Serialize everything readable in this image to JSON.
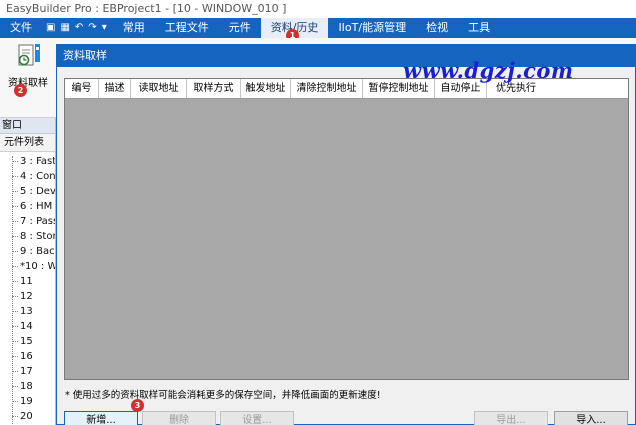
{
  "window": {
    "title": "EasyBuilder Pro : EBProject1 - [10 - WINDOW_010 ]"
  },
  "menubar": {
    "file": "文件",
    "qat_save": "▣",
    "qat_grid": "▦",
    "qat_undo": "↶",
    "qat_redo": "↷",
    "qat_more": "▾",
    "items": [
      "常用",
      "工程文件",
      "元件",
      "资料/历史",
      "IIoT/能源管理",
      "检视",
      "工具"
    ],
    "active_index": 3
  },
  "ribbon": {
    "data_sampling": "资料取样"
  },
  "badges": [
    "1",
    "2",
    "3"
  ],
  "sidebar": {
    "header": "窗口",
    "tab": "元件列表",
    "items": [
      "3 : Fast",
      "4 : Con",
      "5 : Dev",
      "6 : HM",
      "7 : Pass",
      "8 : Stor",
      "9 : Bac",
      "*10 : W",
      "11",
      "12",
      "13",
      "14",
      "15",
      "16",
      "17",
      "18",
      "19",
      "20"
    ]
  },
  "dialog": {
    "title": "资料取样",
    "columns": [
      "编号",
      "描述",
      "读取地址",
      "取样方式",
      "触发地址",
      "清除控制地址",
      "暂停控制地址",
      "自动停止",
      "优先执行"
    ],
    "note": "* 使用过多的资料取样可能会消耗更多的保存空间，并降低画面的更新速度!",
    "buttons": {
      "add": "新增...",
      "delete": "删除",
      "settings": "设置...",
      "export": "导出...",
      "import": "导入..."
    }
  },
  "watermark": "www.dgzj.com",
  "colors": {
    "menubar": "#1565c0",
    "badge": "#d32f2f",
    "grid_body": "#a8a8a8",
    "watermark": "#1d1dd6"
  }
}
